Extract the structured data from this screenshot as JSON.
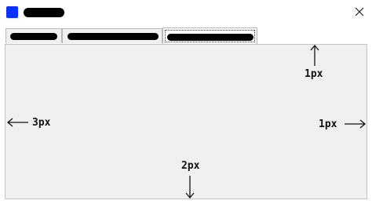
{
  "window": {
    "title": "",
    "icon": "app-icon",
    "accent": "#0a32ff"
  },
  "tabs": [
    {
      "label": "",
      "active": false
    },
    {
      "label": "",
      "active": false
    },
    {
      "label": "",
      "active": true
    }
  ],
  "annotations": {
    "top_label": "1px",
    "left_label": "3px",
    "right_label": "1px",
    "bottom_label": "2px"
  }
}
